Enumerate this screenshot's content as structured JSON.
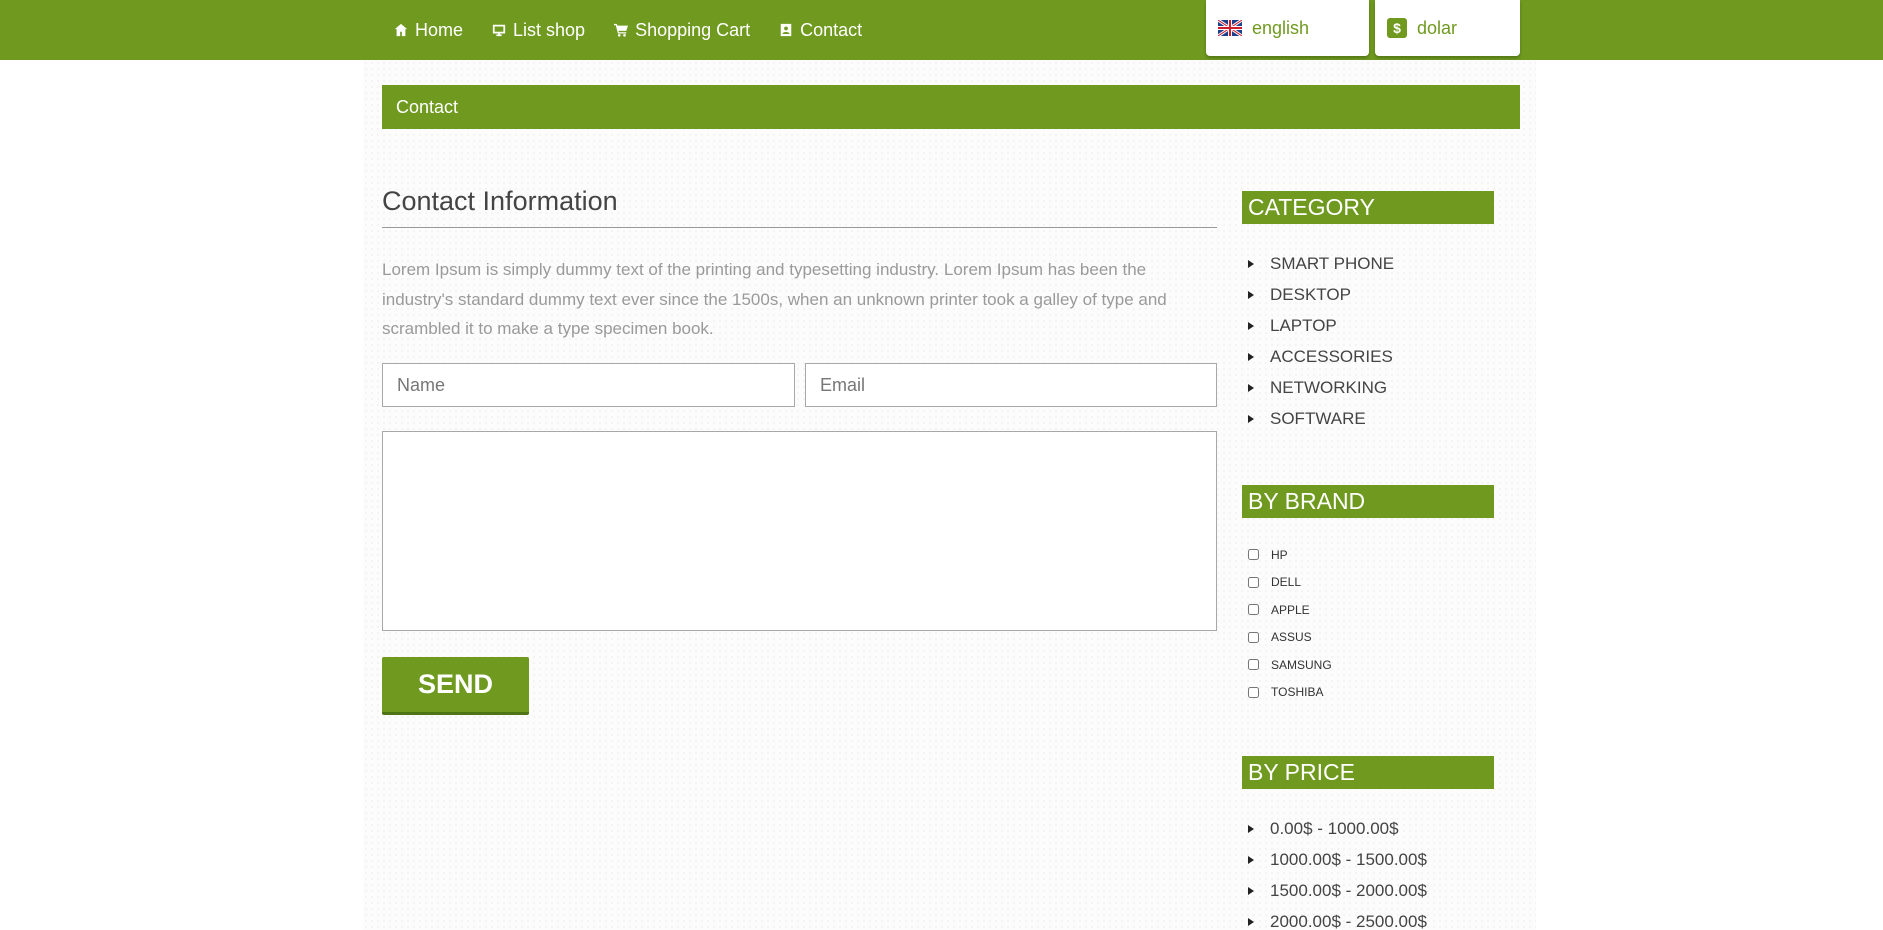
{
  "nav": {
    "items": [
      {
        "label": "Home",
        "icon": "home-icon"
      },
      {
        "label": "List shop",
        "icon": "monitor-icon"
      },
      {
        "label": "Shopping Cart",
        "icon": "cart-icon"
      },
      {
        "label": "Contact",
        "icon": "contact-card-icon"
      }
    ]
  },
  "language": {
    "label": "english",
    "icon": "uk-flag-icon"
  },
  "currency": {
    "label": "dolar",
    "icon": "dollar-icon",
    "symbol": "$"
  },
  "breadcrumb": "Contact",
  "contact": {
    "title": "Contact Information",
    "text": "Lorem Ipsum is simply dummy text of the printing and typesetting industry. Lorem Ipsum has been the industry's standard dummy text ever since the 1500s, when an unknown printer took a galley of type and scrambled it to make a type specimen book.",
    "name_placeholder": "Name",
    "email_placeholder": "Email",
    "send_label": "SEND"
  },
  "sidebar": {
    "category": {
      "title": "CATEGORY",
      "items": [
        "SMART PHONE",
        "DESKTOP",
        "LAPTOP",
        "ACCESSORIES",
        "NETWORKING",
        "SOFTWARE"
      ]
    },
    "brand": {
      "title": "BY BRAND",
      "items": [
        "HP",
        "DELL",
        "APPLE",
        "ASSUS",
        "SAMSUNG",
        "TOSHIBA"
      ]
    },
    "price": {
      "title": "BY PRICE",
      "items": [
        "0.00$ - 1000.00$",
        "1000.00$ - 1500.00$",
        "1500.00$ - 2000.00$",
        "2000.00$ - 2500.00$"
      ]
    }
  },
  "colors": {
    "accent": "#6f9a1f"
  }
}
